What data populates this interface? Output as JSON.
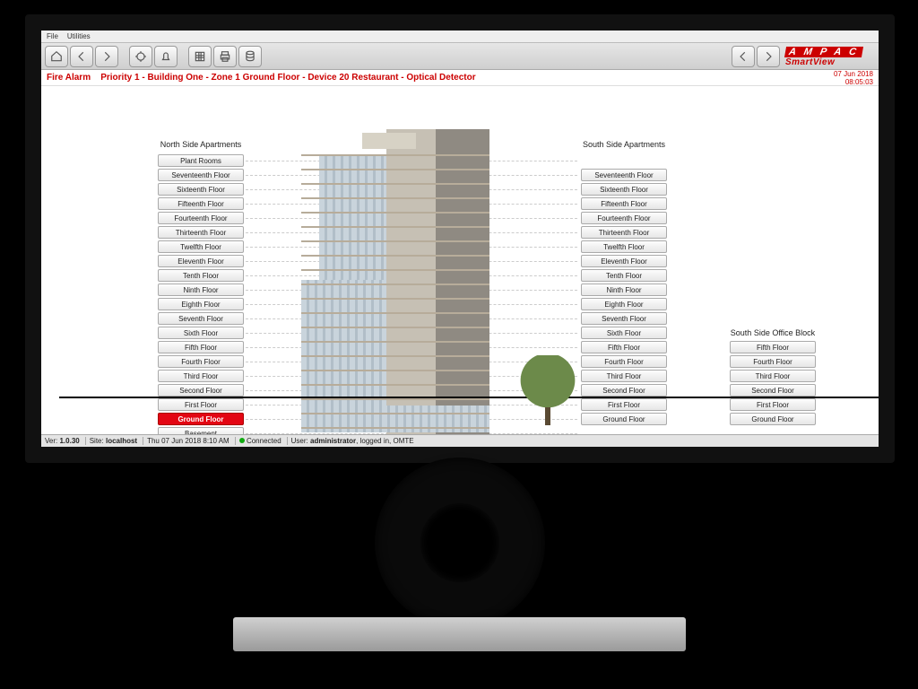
{
  "menubar": {
    "file": "File",
    "utilities": "Utilities"
  },
  "toolbar": {
    "home": "home",
    "back": "back",
    "forward": "forward",
    "alarm": "alarm",
    "bell": "bell",
    "grid": "grid",
    "print": "print",
    "db": "database",
    "nav_left": "nav-left",
    "nav_right": "nav-right"
  },
  "logo": {
    "brand1": "A M P A C",
    "brand2": "SmartView"
  },
  "alarm": {
    "label": "Fire Alarm",
    "detail": "Priority 1 - Building One - Zone 1 Ground Floor - Device 20 Restaurant - Optical Detector",
    "date": "07 Jun 2018",
    "time": "08:05:03"
  },
  "columns": {
    "north": {
      "title": "North Side Apartments",
      "floors": [
        "Plant Rooms",
        "Seventeenth Floor",
        "Sixteenth Floor",
        "Fifteenth Floor",
        "Fourteenth Floor",
        "Thirteenth Floor",
        "Twelfth Floor",
        "Eleventh Floor",
        "Tenth Floor",
        "Ninth Floor",
        "Eighth Floor",
        "Seventh Floor",
        "Sixth Floor",
        "Fifth Floor",
        "Fourth Floor",
        "Third Floor",
        "Second Floor",
        "First Floor",
        "Ground Floor",
        "Basement"
      ],
      "alarm_index": 18
    },
    "south": {
      "title": "South Side Apartments",
      "floors": [
        "Seventeenth Floor",
        "Sixteenth Floor",
        "Fifteenth Floor",
        "Fourteenth Floor",
        "Thirteenth Floor",
        "Twelfth Floor",
        "Eleventh Floor",
        "Tenth Floor",
        "Ninth Floor",
        "Eighth Floor",
        "Seventh Floor",
        "Sixth Floor",
        "Fifth Floor",
        "Fourth Floor",
        "Third Floor",
        "Second Floor",
        "First Floor",
        "Ground Floor"
      ]
    },
    "office": {
      "title": "South Side Office Block",
      "floors": [
        "Fifth Floor",
        "Fourth Floor",
        "Third Floor",
        "Second Floor",
        "First Floor",
        "Ground Floor"
      ]
    }
  },
  "status": {
    "ver_label": "Ver:",
    "ver": "1.0.30",
    "site_label": "Site:",
    "site": "localhost",
    "datetime": "Thu 07 Jun 2018 8:10 AM",
    "conn": "Connected",
    "user_label": "User:",
    "user": "administrator",
    "user_suffix": ", logged in, OMTE"
  }
}
